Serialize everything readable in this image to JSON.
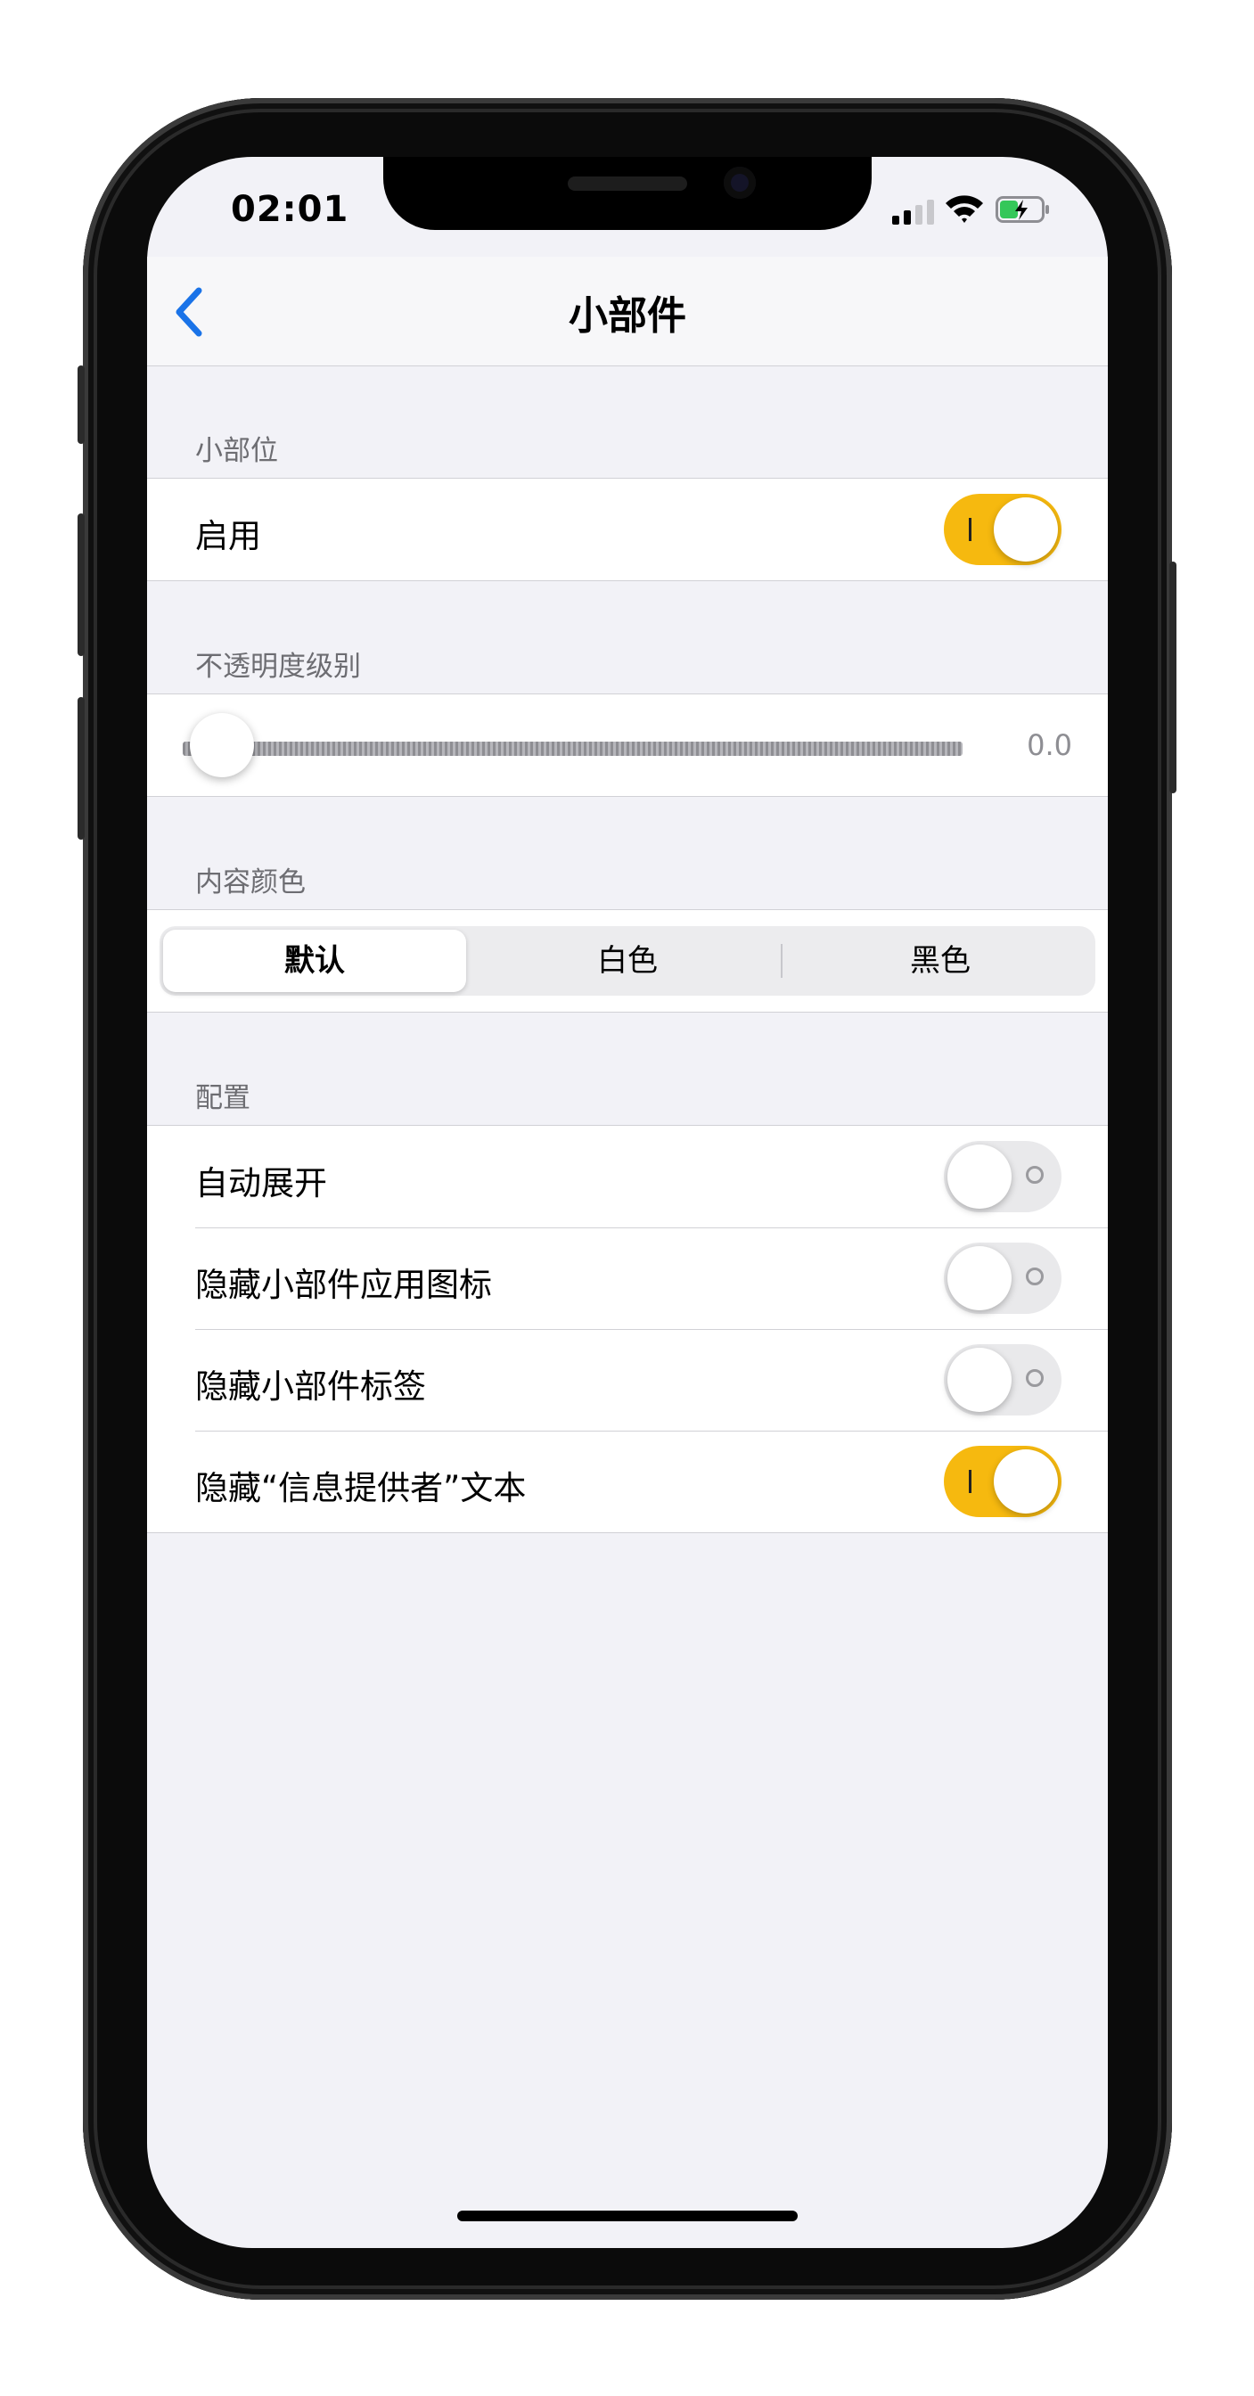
{
  "status_bar": {
    "time": "02:01"
  },
  "nav": {
    "title": "小部件",
    "back_icon": "chevron-left-icon",
    "accent_color": "#1a73e8"
  },
  "sections": {
    "widget": {
      "header": "小部位",
      "enable": {
        "label": "启用",
        "on": true
      }
    },
    "opacity": {
      "header": "不透明度级别",
      "value": "0.0",
      "level": 0.0
    },
    "content_color": {
      "header": "内容颜色",
      "options": [
        "默认",
        "白色",
        "黑色"
      ],
      "selected": "默认"
    },
    "config": {
      "header": "配置",
      "items": [
        {
          "label": "自动展开",
          "on": false
        },
        {
          "label": "隐藏小部件应用图标",
          "on": false
        },
        {
          "label": "隐藏小部件标签",
          "on": false
        },
        {
          "label": "隐藏“信息提供者”文本",
          "on": true
        }
      ]
    }
  },
  "colors": {
    "toggle_on": "#f6b90f",
    "toggle_off": "#e9e9eb",
    "background": "#f2f2f7"
  }
}
